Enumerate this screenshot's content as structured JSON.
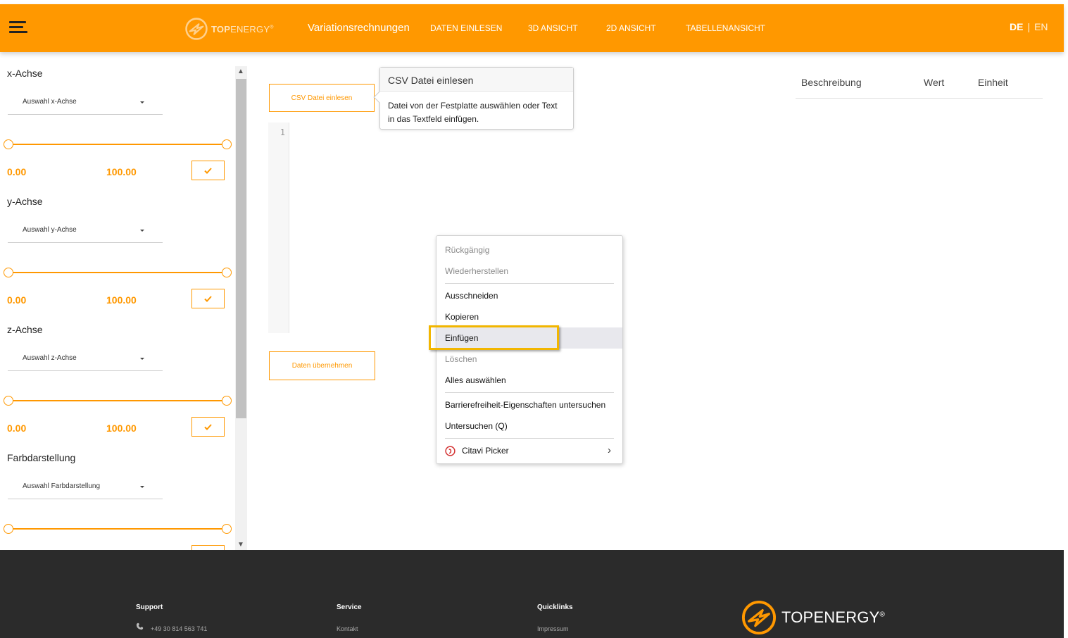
{
  "header": {
    "brand_bold": "TOP",
    "brand_light": "ENERGY",
    "brand_reg": "®",
    "title": "Variationsrechnungen",
    "nav": [
      "DATEN EINLESEN",
      "3D ANSICHT",
      "2D ANSICHT",
      "TABELLENANSICHT"
    ],
    "lang_de": "DE",
    "lang_sep": "|",
    "lang_en": "EN"
  },
  "sidebar": {
    "sections": [
      {
        "label": "x-Achse",
        "select": "Auswahl x-Achse",
        "min": "0.00",
        "max": "100.00"
      },
      {
        "label": "y-Achse",
        "select": "Auswahl y-Achse",
        "min": "0.00",
        "max": "100.00"
      },
      {
        "label": "z-Achse",
        "select": "Auswahl z-Achse",
        "min": "0.00",
        "max": "100.00"
      },
      {
        "label": "Farbdarstellung",
        "select": "Auswahl Farbdarstellung"
      }
    ]
  },
  "main": {
    "csv_button": "CSV Datei einlesen",
    "apply_button": "Daten übernehmen",
    "editor_line": "1",
    "tooltip_title": "CSV Datei einlesen",
    "tooltip_body": "Datei von der Festplatte auswählen oder Text in das Textfeld einfügen."
  },
  "table": {
    "headers": [
      "Beschreibung",
      "Wert",
      "Einheit"
    ]
  },
  "context_menu": {
    "items": [
      {
        "label": "Rückgängig",
        "disabled": true
      },
      {
        "label": "Wiederherstellen",
        "disabled": true
      },
      {
        "label": "Ausschneiden",
        "disabled": false
      },
      {
        "label": "Kopieren",
        "disabled": false
      },
      {
        "label": "Einfügen",
        "disabled": false,
        "highlighted": true
      },
      {
        "label": "Löschen",
        "disabled": true
      },
      {
        "label": "Alles auswählen",
        "disabled": false
      },
      {
        "label": "Barrierefreiheit-Eigenschaften untersuchen",
        "disabled": false
      },
      {
        "label": "Untersuchen (Q)",
        "disabled": false
      },
      {
        "label": "Citavi Picker",
        "disabled": false,
        "submenu": true
      }
    ]
  },
  "footer": {
    "support_head": "Support",
    "support_phone": "+49 30 814 563 741",
    "service_head": "Service",
    "service_item": "Kontakt",
    "quicklinks_head": "Quicklinks",
    "quicklinks_item": "Impressum",
    "brand_bold": "TOP",
    "brand_light": "ENERGY",
    "brand_reg": "®"
  },
  "colors": {
    "accent": "#ff9800",
    "footer_bg": "#2b2b2b",
    "highlight": "#f2b600"
  }
}
